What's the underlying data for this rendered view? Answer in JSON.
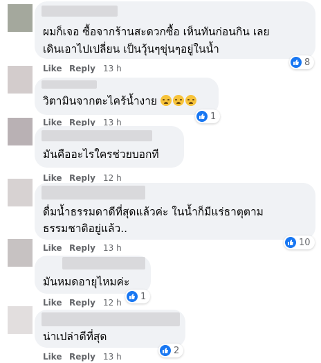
{
  "colors": {
    "accent": "#1877f2",
    "bubble": "#f0f2f5",
    "meta_text": "#65676b"
  },
  "action_labels": {
    "like": "Like",
    "reply": "Reply"
  },
  "comments": [
    {
      "text_lines": [
        "ผมก็เจอ ซื้อจากร้านสะดวกซื้อ เห็นทันก่อนกิน เลย",
        "เดินเอาไปเปลี่ยน เป็นวุ้นๆขุ่นๆอยู่ในน้ำ"
      ],
      "time": "13 h",
      "reactions": "8"
    },
    {
      "text_lines": [
        "วิตามินจากตะไคร้น้ำงาย"
      ],
      "emoji": [
        "weary-face-emoji",
        "weary-face-emoji",
        "weary-face-emoji"
      ],
      "time": "13 h",
      "reactions": "1"
    },
    {
      "text_lines": [
        "มันคืออะไรใครช่วยบอกที"
      ],
      "time": "12 h",
      "reactions": ""
    },
    {
      "text_lines": [
        "ดื่มน้ำธรรมดาดีที่สุดแล้วค่ะ ในน้ำก็มีแร่ธาตุตาม",
        "ธรรมชาติอยู่แล้ว.."
      ],
      "time": "13 h",
      "reactions": "10"
    },
    {
      "text_lines": [
        "มันหมดอายุไหมค่ะ"
      ],
      "time": "12 h",
      "reactions": "1"
    },
    {
      "text_lines": [
        "น่าเปล่าดีที่สุด"
      ],
      "time": "13 h",
      "reactions": "2"
    }
  ]
}
